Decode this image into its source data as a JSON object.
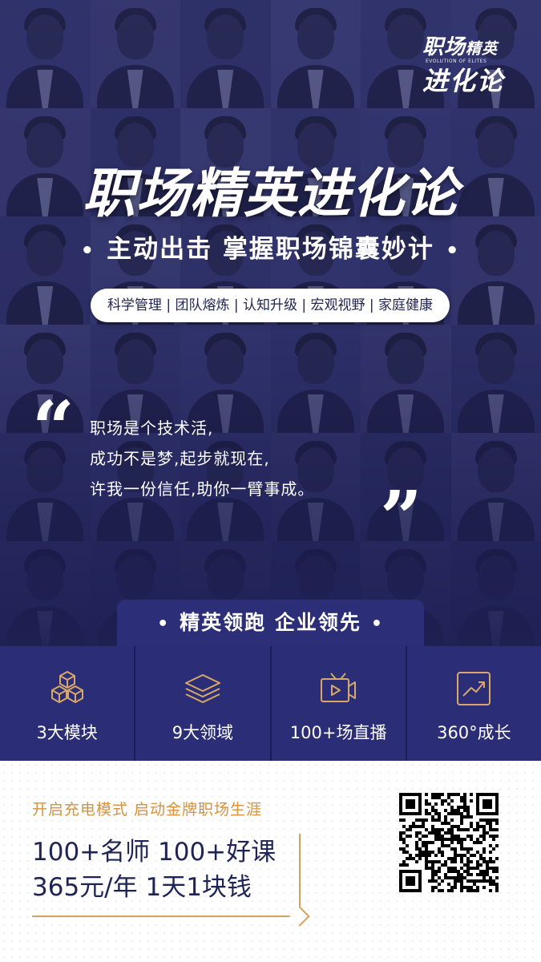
{
  "logo": {
    "line1_a": "职场",
    "line1_b": "精英",
    "tagline": "EVOLUTION OF ELITES",
    "line2": "进化论"
  },
  "title": "职场精英进化论",
  "subtitle": "主动出击 掌握职场锦囊妙计",
  "subtitle_dot": "•",
  "tags": "科学管理 | 团队熔炼 | 认知升级 | 宏观视野 | 家庭健康",
  "quote": {
    "open_mark": "“",
    "close_mark": "”",
    "lines": [
      "职场是个技术活,",
      "成功不是梦,起步就现在,",
      "许我一份信任,助你一臂事成。"
    ]
  },
  "banner": {
    "text": "精英领跑  企业领先",
    "dot": "•"
  },
  "features": [
    {
      "icon": "cubes-icon",
      "label": "3大模块"
    },
    {
      "icon": "layers-icon",
      "label": "9大领域"
    },
    {
      "icon": "tv-play-icon",
      "label": "100+场直播"
    },
    {
      "icon": "growth-chart-icon",
      "label": "360°成长"
    }
  ],
  "cta": "开启充电模式 启动金牌职场生涯",
  "stats": {
    "line1": "100+名师  100+好课",
    "line2": "365元/年  1天1块钱"
  },
  "colors": {
    "navy": "#2b2e76",
    "gold": "#d6923c",
    "text_dark": "#1e2455",
    "background": "#1f2150"
  }
}
